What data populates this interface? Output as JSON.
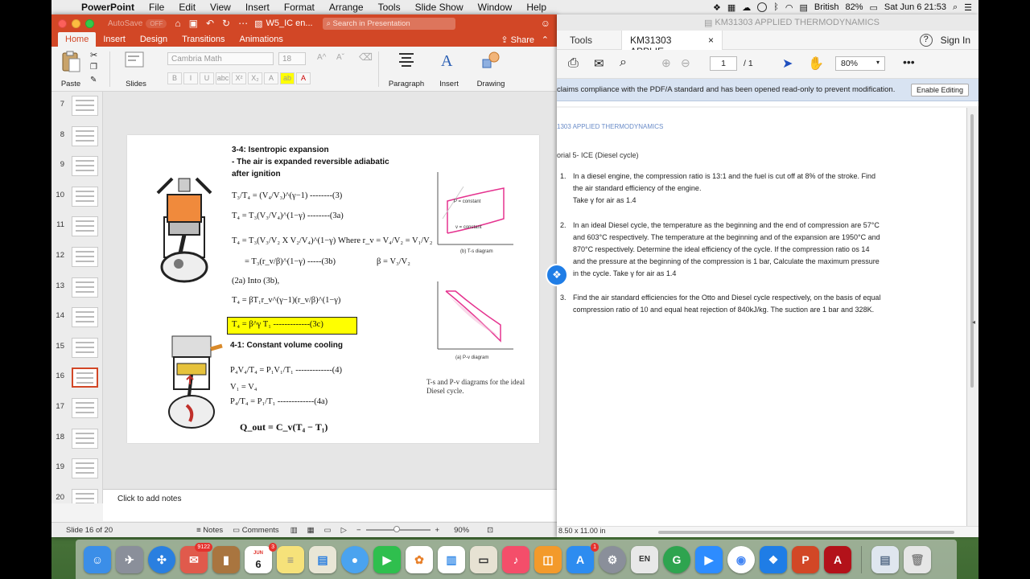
{
  "menubar": {
    "app_name": "PowerPoint",
    "items": [
      "File",
      "Edit",
      "View",
      "Insert",
      "Format",
      "Arrange",
      "Tools",
      "Slide Show",
      "Window",
      "Help"
    ],
    "battery": "82%",
    "input_source": "British",
    "clock": "Sat Jun 6  21:53"
  },
  "ppt": {
    "autosave_label": "AutoSave",
    "autosave_state": "OFF",
    "doc_name": "W5_IC en...",
    "search_placeholder": "Search in Presentation",
    "tabs": [
      "Home",
      "Insert",
      "Design",
      "Transitions",
      "Animations"
    ],
    "share_label": "Share",
    "ribbon": {
      "paste": "Paste",
      "slides": "Slides",
      "font_name": "Cambria Math",
      "font_size": "18",
      "format_buttons": [
        "B",
        "I",
        "U",
        "abc",
        "X²",
        "X₂"
      ],
      "paragraph": "Paragraph",
      "insert": "Insert",
      "drawing": "Drawing"
    },
    "slide_numbers": [
      "7",
      "8",
      "9",
      "10",
      "11",
      "12",
      "13",
      "14",
      "15",
      "16",
      "17",
      "18",
      "19",
      "20"
    ],
    "selected_slide": "16",
    "notes_placeholder": "Click to add notes",
    "status": {
      "slide_info": "Slide 16 of 20",
      "notes": "Notes",
      "comments": "Comments",
      "zoom": "90%"
    }
  },
  "slide": {
    "heading1": "3-4: Isentropic expansion",
    "heading2": "- The air is expanded reversible adiabatic",
    "heading3": "after ignition",
    "eq3": "T₃/T₄ = (V₄/V₃)^(γ−1) --------(3)",
    "eq3a": "T₄ = T₃(V₃/V₄)^(1−γ) --------(3a)",
    "eq3b_1": "T₄ = T₃(V₃/V₂ X V₂/V₄)^(1−γ)",
    "where": "Where  r_v = V₄/V₂ = V₁/V₂",
    "eq3b_2": "= T₃(r_v/β)^(1−γ) -----(3b)",
    "beta": "β = V₃/V₂",
    "into": "(2a) Into (3b),",
    "eq_sub": "T₄ = βT₁r_v^(γ−1)(r_v/β)^(1−γ)",
    "eq3c": "T₄ = β^γ T₁ -------------(3c)",
    "heading4": "4-1: Constant volume cooling",
    "eq4": "P₄V₄/T₄ = P₁V₁/T₁ -------------(4)",
    "eq4v": "V₁ = V₄",
    "eq4a": "P₄/T₄ = P₁/T₁ -------------(4a)",
    "qout": "Q_out = C_v(T₄ − T₁)",
    "caption": "T-s and P-v diagrams for the ideal Diesel cycle.",
    "ts_caption": "(b) T-s diagram",
    "pv_caption": "(a) P-v diagram",
    "p_const": "P = constant",
    "v_const": "v = constant"
  },
  "acrobat": {
    "window_title": "KM31303 APPLIED THERMODYNAMICS",
    "tools_tab": "Tools",
    "doc_tab": "KM31303 APPLIE...",
    "help": "?",
    "sign_in": "Sign In",
    "page_current": "1",
    "page_total": "/ 1",
    "zoom": "80%",
    "banner": "claims compliance with the PDF/A standard and has been opened read-only to prevent modification.",
    "enable_editing": "Enable Editing",
    "page_header": "1303 APPLIED THERMODYNAMICS",
    "tutorial_title": "orial 5- ICE (Diesel cycle)",
    "questions": [
      {
        "num": "1.",
        "lines": [
          "In a diesel engine, the compression ratio is 13:1 and the fuel is cut off at 8% of the stroke. Find",
          "the air standard efficiency of the engine.",
          "Take γ for air as 1.4"
        ]
      },
      {
        "num": "2.",
        "lines": [
          "In an ideal Diesel cycle, the temperature as the beginning and the end of compression are 57°C",
          "and 603°C respectively. The temperature at the beginning and of the expansion are 1950°C and",
          "870°C respectively. Determine the ideal efficiency of the cycle. If the compression ratio os 14",
          "and the pressure at the beginning of the compression is 1 bar, Calculate the maximum pressure",
          "in the cycle. Take γ for air as 1.4"
        ]
      },
      {
        "num": "3.",
        "lines": [
          "Find the air standard efficiencies for the Otto and Diesel cycle respectively, on the basis of equal",
          "compression ratio of 10 and equal heat rejection of 840kJ/kg. The suction are 1 bar and 328K."
        ]
      }
    ],
    "page_size": "8.50 x 11.00 in"
  },
  "dock": {
    "calendar_month": "JUN",
    "calendar_day": "6",
    "badges": {
      "photos": "9122",
      "calendar": "3",
      "appstore": "1"
    }
  },
  "colors": {
    "ppt_accent": "#d24726",
    "acrobat_banner": "#d8e3f2",
    "highlight": "#ffff00"
  }
}
